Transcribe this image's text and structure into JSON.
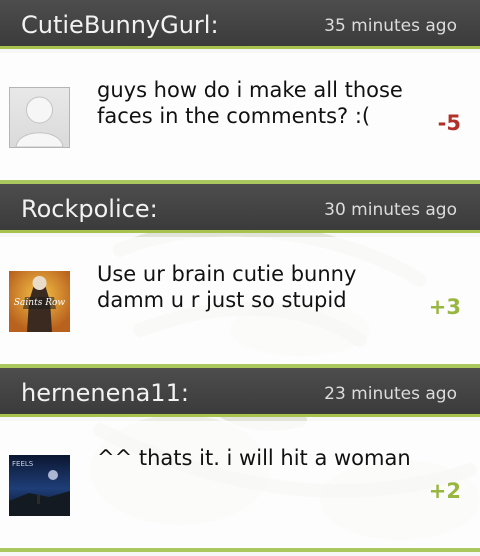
{
  "comments": [
    {
      "username": "CutieBunnyGurl:",
      "time": "35 minutes ago",
      "message": "guys how do i make all those faces in the comments? :(",
      "score": "-5",
      "score_color": "#b0302a",
      "avatar": "default-avatar"
    },
    {
      "username": "Rockpolice:",
      "time": "30 minutes ago",
      "message": "Use ur brain cutie bunny damm u r just so stupid",
      "score": "+3",
      "score_color": "#98b640",
      "avatar": "saints-row-avatar",
      "avatar_text": "Saints Row"
    },
    {
      "username": "hernenena11:",
      "time": "23 minutes ago",
      "message": "^^ thats it. i will hit a woman",
      "score": "+2",
      "score_color": "#98b640",
      "avatar": "feels-avatar",
      "avatar_text": "FEELS"
    }
  ],
  "colors": {
    "accent": "#a7c24d",
    "header": "#3f3f3f"
  }
}
